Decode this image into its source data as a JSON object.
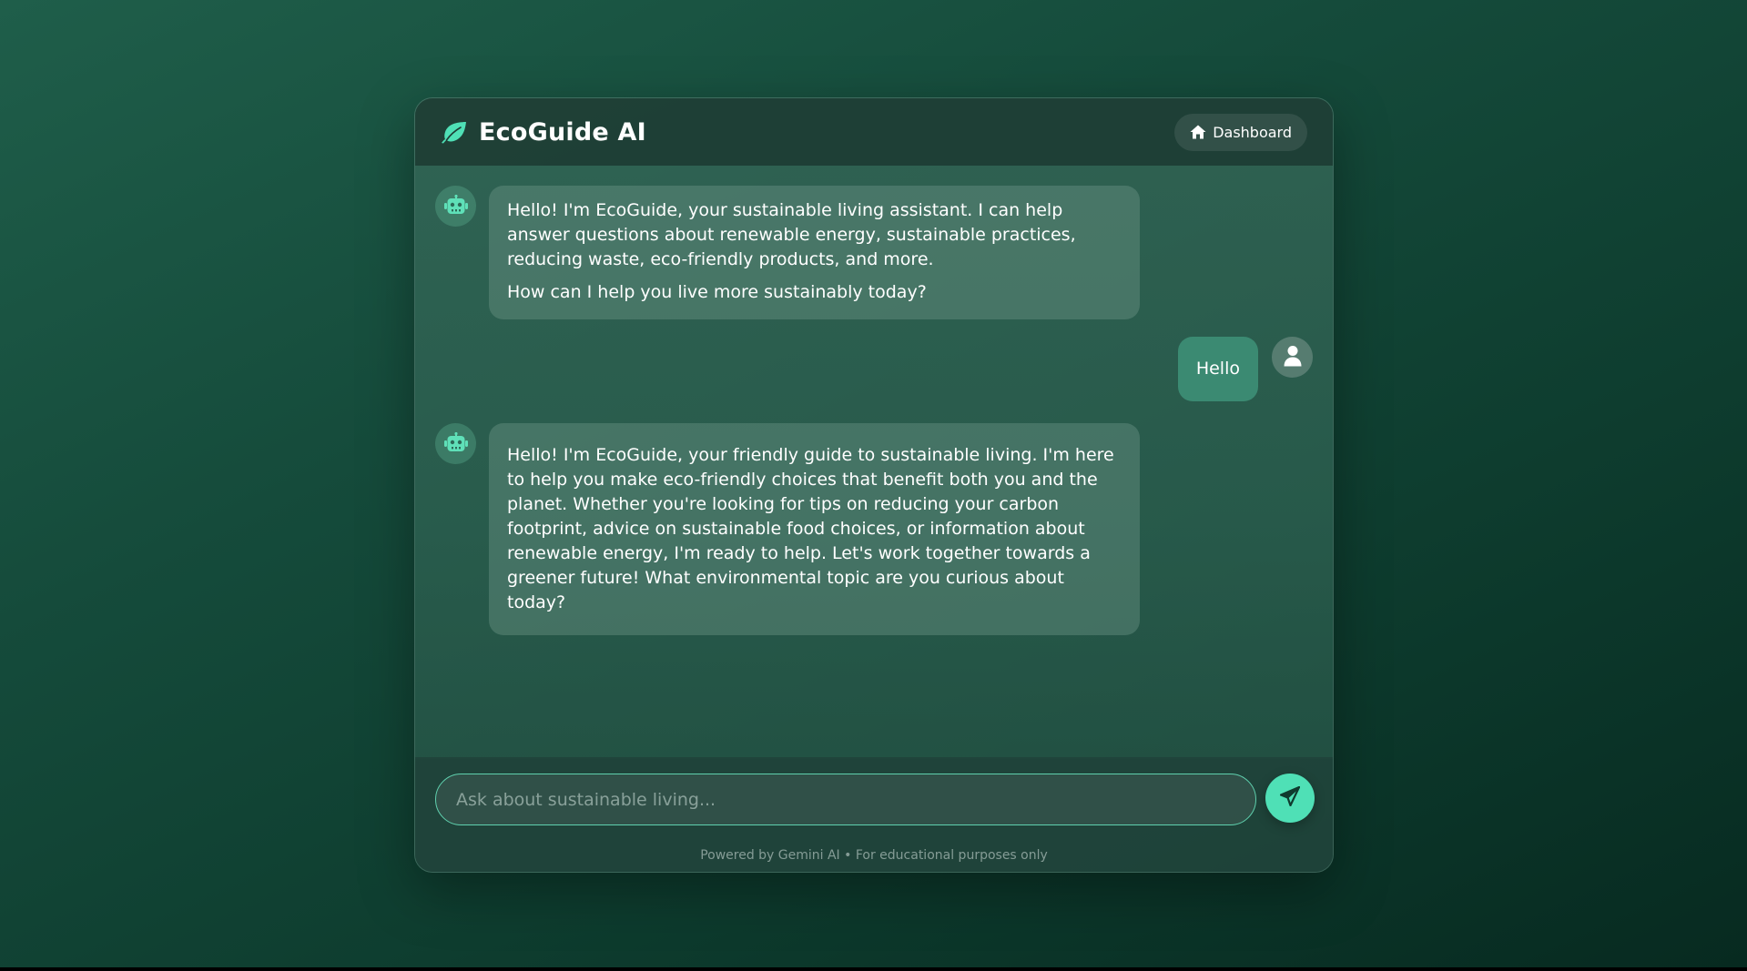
{
  "app": {
    "title": "EcoGuide AI",
    "brand_icon": "leaf-icon"
  },
  "header": {
    "dashboard_label": "Dashboard",
    "dashboard_icon": "home-icon"
  },
  "messages": [
    {
      "role": "bot",
      "avatar_icon": "robot-icon",
      "paragraphs": [
        "Hello! I'm EcoGuide, your sustainable living assistant. I can help answer questions about renewable energy, sustainable practices, reducing waste, eco-friendly products, and more.",
        "How can I help you live more sustainably today?"
      ]
    },
    {
      "role": "user",
      "avatar_icon": "user-icon",
      "text": "Hello"
    },
    {
      "role": "bot",
      "avatar_icon": "robot-icon",
      "paragraphs": [
        "Hello! I'm EcoGuide, your friendly guide to sustainable living. I'm here to help you make eco-friendly choices that benefit both you and the planet. Whether you're looking for tips on reducing your carbon footprint, advice on sustainable food choices, or information about renewable energy, I'm ready to help. Let's work together towards a greener future! What environmental topic are you curious about today?"
      ]
    }
  ],
  "composer": {
    "placeholder": "Ask about sustainable living...",
    "value": "",
    "send_icon": "send-icon"
  },
  "footer": {
    "note": "Powered by Gemini AI • For educational purposes only"
  },
  "colors": {
    "accent": "#4fe0b6",
    "user_bubble": "#3b8a72",
    "input_border": "#5fd0ae"
  }
}
